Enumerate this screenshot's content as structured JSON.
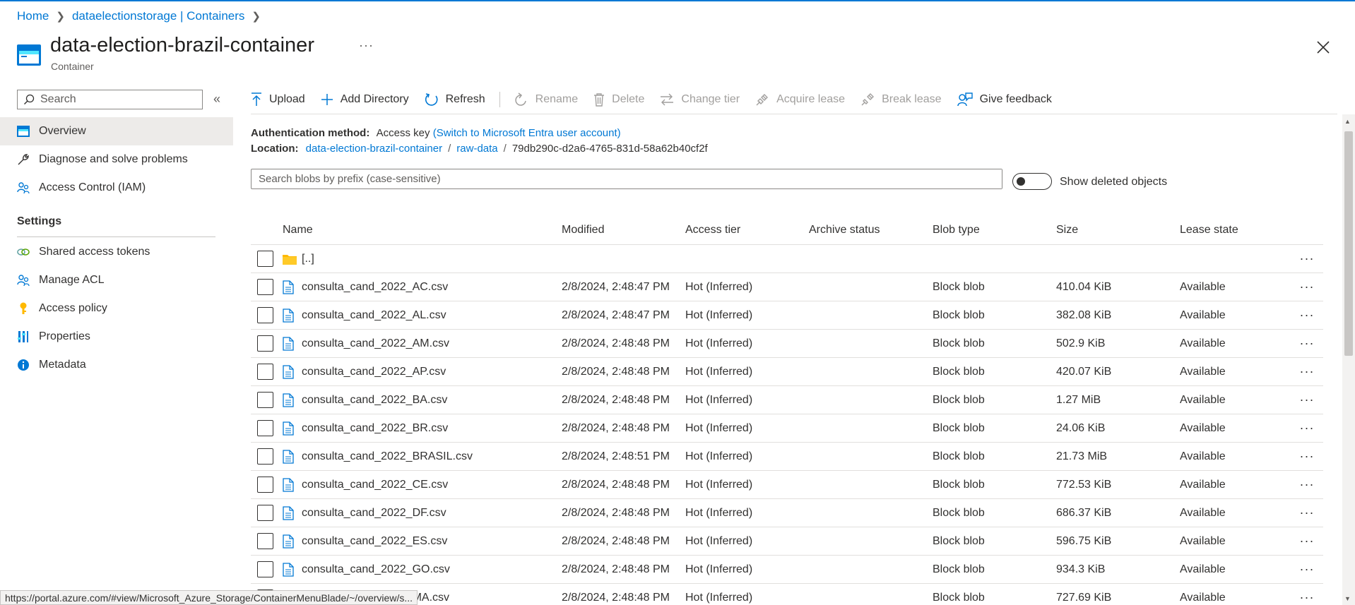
{
  "breadcrumb": {
    "home": "Home",
    "storage": "dataelectionstorage | Containers"
  },
  "header": {
    "title": "data-election-brazil-container",
    "subtitle": "Container",
    "more": "···"
  },
  "nav": {
    "search_placeholder": "Search",
    "collapse": "«",
    "items": [
      {
        "label": "Overview",
        "icon": "overview-icon"
      },
      {
        "label": "Diagnose and solve problems",
        "icon": "wrench-icon"
      },
      {
        "label": "Access Control (IAM)",
        "icon": "people-icon"
      }
    ],
    "settings_title": "Settings",
    "settings_items": [
      {
        "label": "Shared access tokens",
        "icon": "link-icon"
      },
      {
        "label": "Manage ACL",
        "icon": "people-icon"
      },
      {
        "label": "Access policy",
        "icon": "key-icon"
      },
      {
        "label": "Properties",
        "icon": "properties-icon"
      },
      {
        "label": "Metadata",
        "icon": "info-icon"
      }
    ]
  },
  "toolbar": {
    "upload": "Upload",
    "add_directory": "Add Directory",
    "refresh": "Refresh",
    "rename": "Rename",
    "delete": "Delete",
    "change_tier": "Change tier",
    "acquire_lease": "Acquire lease",
    "break_lease": "Break lease",
    "feedback": "Give feedback"
  },
  "info": {
    "auth_label": "Authentication method:",
    "auth_value": "Access key",
    "auth_switch": "(Switch to Microsoft Entra user account)",
    "location_label": "Location:",
    "loc_container": "data-election-brazil-container",
    "loc_folder": "raw-data",
    "loc_id": "79db290c-d2a6-4765-831d-58a62b40cf2f"
  },
  "blob_search": {
    "placeholder": "Search blobs by prefix (case-sensitive)"
  },
  "toggle": {
    "label": "Show deleted objects",
    "on": false
  },
  "table": {
    "headers": {
      "name": "Name",
      "modified": "Modified",
      "tier": "Access tier",
      "archive": "Archive status",
      "type": "Blob type",
      "size": "Size",
      "lease": "Lease state"
    },
    "parent": "[..]",
    "rows": [
      {
        "name": "consulta_cand_2022_AC.csv",
        "modified": "2/8/2024, 2:48:47 PM",
        "tier": "Hot (Inferred)",
        "archive": "",
        "type": "Block blob",
        "size": "410.04 KiB",
        "lease": "Available"
      },
      {
        "name": "consulta_cand_2022_AL.csv",
        "modified": "2/8/2024, 2:48:47 PM",
        "tier": "Hot (Inferred)",
        "archive": "",
        "type": "Block blob",
        "size": "382.08 KiB",
        "lease": "Available"
      },
      {
        "name": "consulta_cand_2022_AM.csv",
        "modified": "2/8/2024, 2:48:48 PM",
        "tier": "Hot (Inferred)",
        "archive": "",
        "type": "Block blob",
        "size": "502.9 KiB",
        "lease": "Available"
      },
      {
        "name": "consulta_cand_2022_AP.csv",
        "modified": "2/8/2024, 2:48:48 PM",
        "tier": "Hot (Inferred)",
        "archive": "",
        "type": "Block blob",
        "size": "420.07 KiB",
        "lease": "Available"
      },
      {
        "name": "consulta_cand_2022_BA.csv",
        "modified": "2/8/2024, 2:48:48 PM",
        "tier": "Hot (Inferred)",
        "archive": "",
        "type": "Block blob",
        "size": "1.27 MiB",
        "lease": "Available"
      },
      {
        "name": "consulta_cand_2022_BR.csv",
        "modified": "2/8/2024, 2:48:48 PM",
        "tier": "Hot (Inferred)",
        "archive": "",
        "type": "Block blob",
        "size": "24.06 KiB",
        "lease": "Available"
      },
      {
        "name": "consulta_cand_2022_BRASIL.csv",
        "modified": "2/8/2024, 2:48:51 PM",
        "tier": "Hot (Inferred)",
        "archive": "",
        "type": "Block blob",
        "size": "21.73 MiB",
        "lease": "Available"
      },
      {
        "name": "consulta_cand_2022_CE.csv",
        "modified": "2/8/2024, 2:48:48 PM",
        "tier": "Hot (Inferred)",
        "archive": "",
        "type": "Block blob",
        "size": "772.53 KiB",
        "lease": "Available"
      },
      {
        "name": "consulta_cand_2022_DF.csv",
        "modified": "2/8/2024, 2:48:48 PM",
        "tier": "Hot (Inferred)",
        "archive": "",
        "type": "Block blob",
        "size": "686.37 KiB",
        "lease": "Available"
      },
      {
        "name": "consulta_cand_2022_ES.csv",
        "modified": "2/8/2024, 2:48:48 PM",
        "tier": "Hot (Inferred)",
        "archive": "",
        "type": "Block blob",
        "size": "596.75 KiB",
        "lease": "Available"
      },
      {
        "name": "consulta_cand_2022_GO.csv",
        "modified": "2/8/2024, 2:48:48 PM",
        "tier": "Hot (Inferred)",
        "archive": "",
        "type": "Block blob",
        "size": "934.3 KiB",
        "lease": "Available"
      },
      {
        "name": "consulta_cand_2022_MA.csv",
        "modified": "2/8/2024, 2:48:48 PM",
        "tier": "Hot (Inferred)",
        "archive": "",
        "type": "Block blob",
        "size": "727.69 KiB",
        "lease": "Available"
      }
    ]
  },
  "status_url": "https://portal.azure.com/#view/Microsoft_Azure_Storage/ContainerMenuBlade/~/overview/s...",
  "colors": {
    "accent": "#0078d4",
    "text": "#323130",
    "muted": "#a19f9d",
    "nav_active": "#edebe9"
  }
}
